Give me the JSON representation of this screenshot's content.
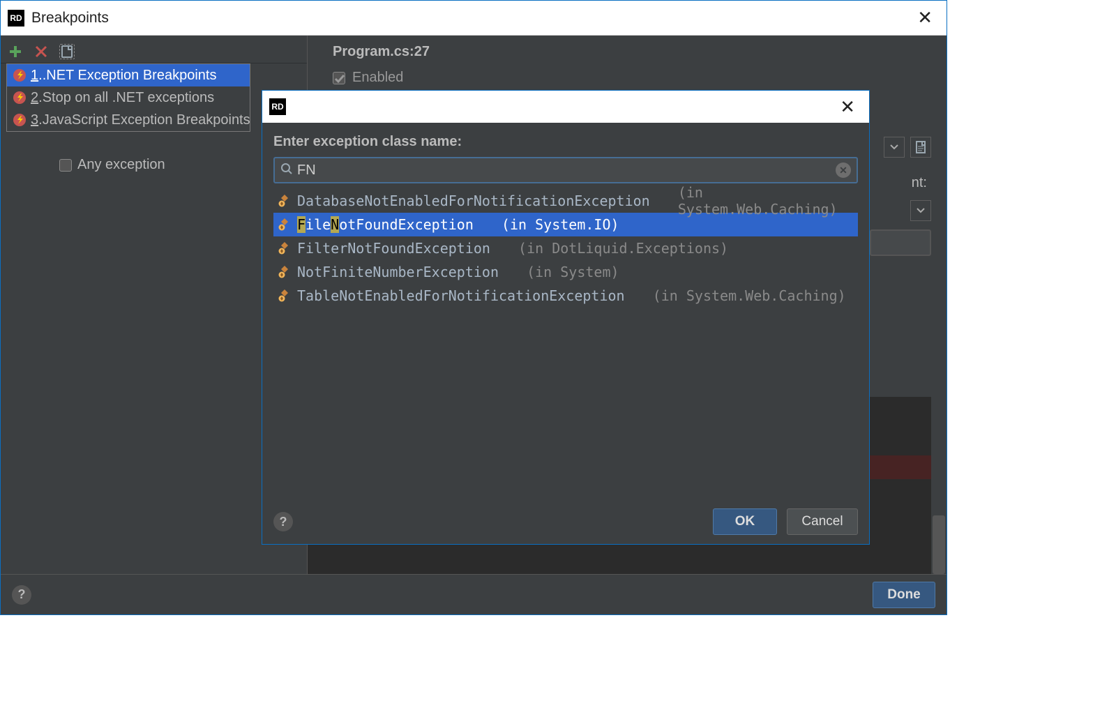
{
  "window": {
    "title": "Breakpoints",
    "logo": "RD"
  },
  "toolbar": {
    "add_tooltip": "Add",
    "remove_tooltip": "Remove",
    "doc_tooltip": "Document"
  },
  "add_menu": {
    "items": [
      {
        "num": "1",
        "label": ".NET Exception Breakpoints"
      },
      {
        "num": "2",
        "label": "Stop on all .NET exceptions"
      },
      {
        "num": "3",
        "label": "JavaScript Exception Breakpoints"
      }
    ]
  },
  "tree": {
    "any_exception": "Any exception"
  },
  "details": {
    "file_title": "Program.cs:27",
    "enabled_label": "Enabled",
    "nt_label_suffix": "nt:"
  },
  "footer": {
    "done_label": "Done"
  },
  "modal": {
    "logo": "RD",
    "heading": "Enter exception class name:",
    "search_value": "FN",
    "ok_label": "OK",
    "cancel_label": "Cancel",
    "results": [
      {
        "name": "DatabaseNotEnabledForNotificationException",
        "ns": "(in System.Web.Caching)",
        "selected": false,
        "hl": []
      },
      {
        "name": "FileNotFoundException",
        "ns": "(in System.IO)",
        "selected": true,
        "hl": [
          [
            0,
            1
          ],
          [
            4,
            5
          ]
        ]
      },
      {
        "name": "FilterNotFoundException",
        "ns": "(in DotLiquid.Exceptions)",
        "selected": false,
        "hl": []
      },
      {
        "name": "NotFiniteNumberException",
        "ns": "(in System)",
        "selected": false,
        "hl": []
      },
      {
        "name": "TableNotEnabledForNotificationException",
        "ns": "(in System.Web.Caching)",
        "selected": false,
        "hl": []
      }
    ]
  }
}
